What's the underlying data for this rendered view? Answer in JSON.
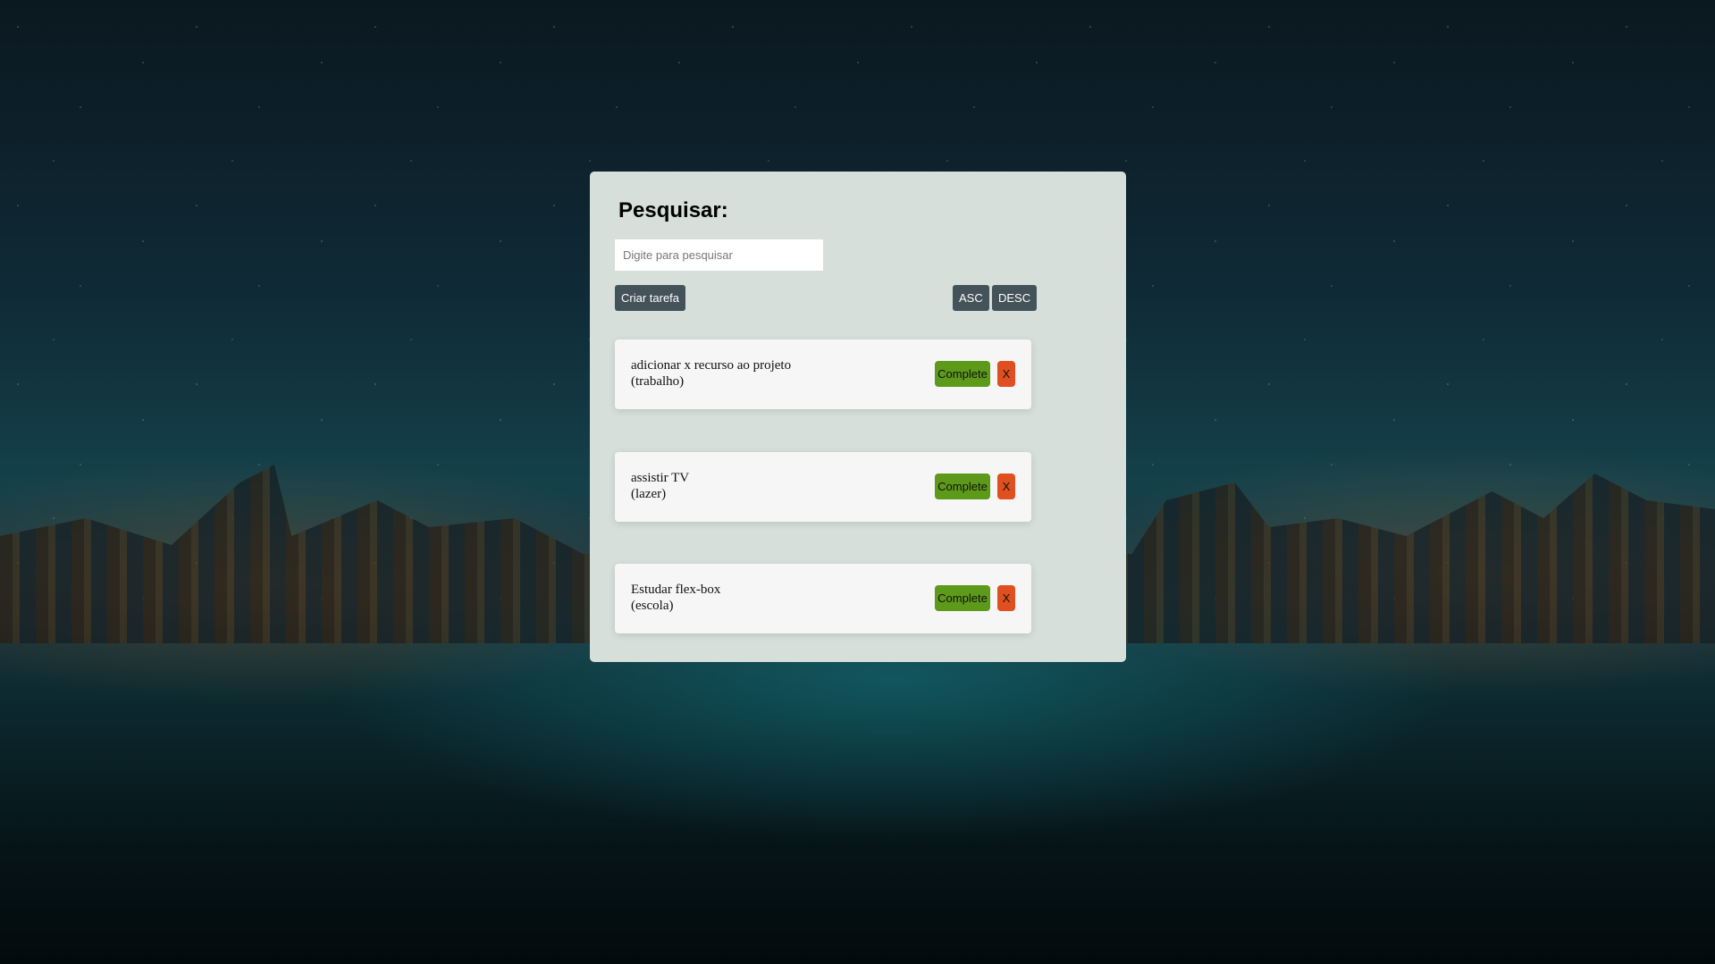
{
  "search": {
    "title": "Pesquisar:",
    "placeholder": "Digite para pesquisar",
    "value": ""
  },
  "toolbar": {
    "create_label": "Criar tarefa",
    "asc_label": "ASC",
    "desc_label": "DESC"
  },
  "tasks": [
    {
      "name": "adicionar x recurso ao projeto",
      "category": "(trabalho)",
      "complete_label": "Complete",
      "delete_label": "X"
    },
    {
      "name": "assistir TV",
      "category": "(lazer)",
      "complete_label": "Complete",
      "delete_label": "X"
    },
    {
      "name": "Estudar flex-box",
      "category": "(escola)",
      "complete_label": "Complete",
      "delete_label": "X"
    }
  ],
  "colors": {
    "panel": "#d6dfda",
    "dark_button": "#44525a",
    "complete": "#5e9a1a",
    "delete": "#e04f1f"
  }
}
